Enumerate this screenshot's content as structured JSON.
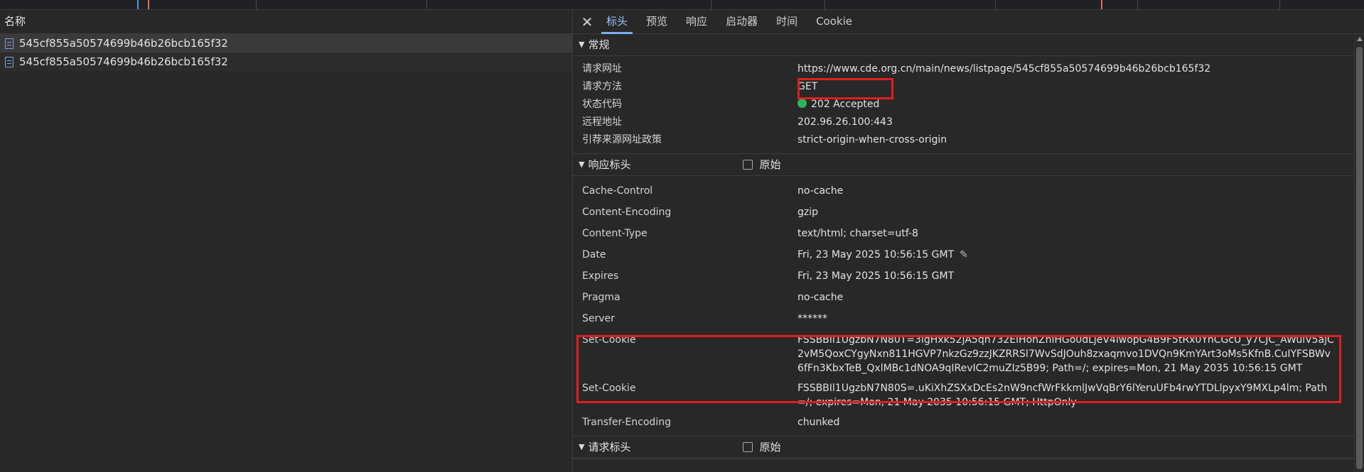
{
  "colors": {
    "accent_tab": "#7cacf8",
    "status_ok": "#2db55d",
    "highlight_box": "#e21e1e"
  },
  "list": {
    "header": "名称",
    "items": [
      {
        "name": "545cf855a50574699b46b26bcb165f32"
      },
      {
        "name": "545cf855a50574699b46b26bcb165f32"
      }
    ]
  },
  "tabs": [
    {
      "label": "标头"
    },
    {
      "label": "预览"
    },
    {
      "label": "响应"
    },
    {
      "label": "启动器"
    },
    {
      "label": "时间"
    },
    {
      "label": "Cookie"
    }
  ],
  "general": {
    "title": "常规",
    "rows": [
      {
        "key": "请求网址",
        "value": "https://www.cde.org.cn/main/news/listpage/545cf855a50574699b46b26bcb165f32"
      },
      {
        "key": "请求方法",
        "value": "GET"
      },
      {
        "key": "状态代码",
        "value": "202 Accepted"
      },
      {
        "key": "远程地址",
        "value": "202.96.26.100:443"
      },
      {
        "key": "引荐来源网址政策",
        "value": "strict-origin-when-cross-origin"
      }
    ]
  },
  "response_headers": {
    "title": "响应标头",
    "raw_label": "原始",
    "rows": [
      {
        "key": "Cache-Control",
        "value": "no-cache"
      },
      {
        "key": "Content-Encoding",
        "value": "gzip"
      },
      {
        "key": "Content-Type",
        "value": "text/html; charset=utf-8"
      },
      {
        "key": "Date",
        "value": "Fri, 23 May 2025 10:56:15 GMT"
      },
      {
        "key": "Expires",
        "value": "Fri, 23 May 2025 10:56:15 GMT"
      },
      {
        "key": "Pragma",
        "value": "no-cache"
      },
      {
        "key": "Server",
        "value": "******"
      },
      {
        "key": "Set-Cookie",
        "value": "FSSBBIl1UgzbN7N80T=3igHxk52jA5qn732ElHonZhiHGo0dLjeV4lwopG4B9F5tRx0YnCGcU_y7CJC_AWuiV5ajC2vM5QoxCYgyNxn811HGVP7nkzGz9zzJKZRRSl7WvSdJOuh8zxaqmvo1DVQn9KmYArt3oMs5KfnB.CuIYFSBWv6fFn3KbxTeB_QxlMBc1dNOA9qIRevIC2muZIz5B99; Path=/; expires=Mon, 21 May 2035 10:56:15 GMT"
      },
      {
        "key": "Set-Cookie",
        "value": "FSSBBIl1UgzbN7N80S=.uKiXhZSXxDcEs2nW9ncfWrFkkmlJwVqBrY6lYeruUFb4rwYTDLlpyxY9MXLp4lm; Path=/; expires=Mon, 21 May 2035 10:56:15 GMT; HttpOnly"
      },
      {
        "key": "Transfer-Encoding",
        "value": "chunked"
      }
    ]
  },
  "request_headers": {
    "title": "请求标头",
    "raw_label": "原始"
  }
}
